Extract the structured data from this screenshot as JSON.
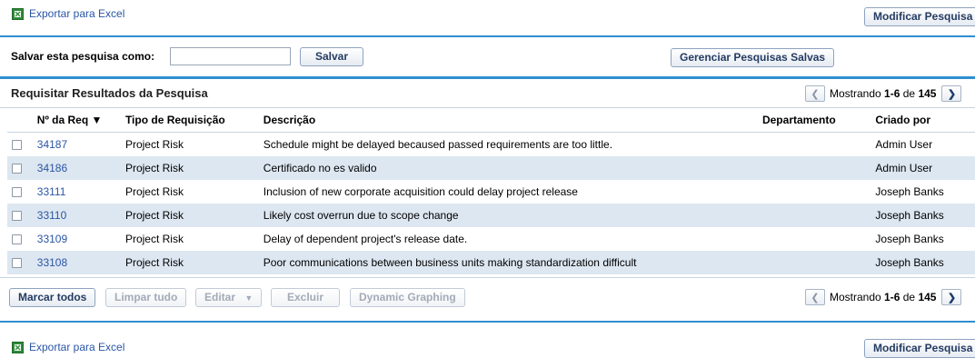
{
  "export": {
    "label": "Exportar para Excel",
    "icon": "excel-icon"
  },
  "modify_search_label": "Modificar Pesquisa",
  "save_search": {
    "label": "Salvar esta pesquisa como:",
    "input_value": "",
    "save_button": "Salvar",
    "manage_button": "Gerenciar Pesquisas Salvas"
  },
  "results": {
    "title": "Requisitar Resultados da Pesquisa",
    "pager": {
      "prefix": "Mostrando",
      "range": "1-6",
      "of": "de",
      "total": "145"
    },
    "columns": {
      "num": "Nº da Req ▼",
      "type": "Tipo de Requisição",
      "desc": "Descrição",
      "dept": "Departamento",
      "user": "Criado por"
    },
    "rows": [
      {
        "num": "34187",
        "type": "Project Risk",
        "desc": "Schedule might be delayed becaused passed requirements are too little.",
        "dept": "",
        "user": "Admin User"
      },
      {
        "num": "34186",
        "type": "Project Risk",
        "desc": "Certificado no es valido",
        "dept": "",
        "user": "Admin User"
      },
      {
        "num": "33111",
        "type": "Project Risk",
        "desc": "Inclusion of new corporate acquisition could delay project release",
        "dept": "",
        "user": "Joseph Banks"
      },
      {
        "num": "33110",
        "type": "Project Risk",
        "desc": "Likely cost overrun due to scope change",
        "dept": "",
        "user": "Joseph Banks"
      },
      {
        "num": "33109",
        "type": "Project Risk",
        "desc": "Delay of dependent project's release date.",
        "dept": "",
        "user": "Joseph Banks"
      },
      {
        "num": "33108",
        "type": "Project Risk",
        "desc": "Poor communications between business units making standardization difficult",
        "dept": "",
        "user": "Joseph Banks"
      }
    ]
  },
  "actions": {
    "mark_all": "Marcar todos",
    "clear_all": "Limpar tudo",
    "edit": "Editar",
    "edit_icon": "caret-down-icon",
    "delete": "Excluir",
    "graphing": "Dynamic Graphing"
  },
  "colors": {
    "accent_line": "#2f8fd0",
    "link": "#2a55a5",
    "alt_row": "#dde7f1"
  }
}
